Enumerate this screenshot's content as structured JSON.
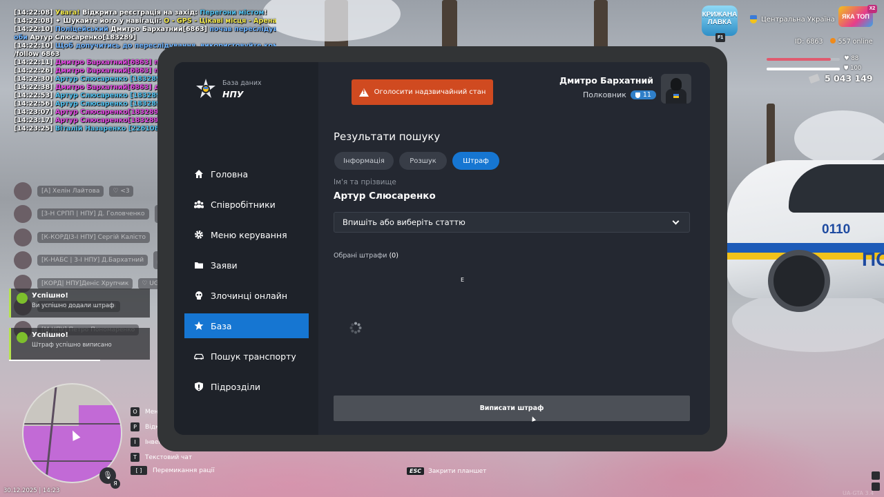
{
  "chat": [
    {
      "time": "[14:22:08]",
      "parts": [
        {
          "t": " Увага! ",
          "c": "c-yellow"
        },
        {
          "t": "Відкрита реєстрація на захід: ",
          "c": "c-white"
        },
        {
          "t": "Перегони містом",
          "c": "c-cyan"
        },
        {
          "t": "!",
          "c": "c-white"
        }
      ]
    },
    {
      "time": "[14:22:08]",
      "parts": [
        {
          "t": " ✦  Шукайте його у навігації: ",
          "c": "c-white"
        },
        {
          "t": "O - GPS - Цікаві місця - Арена",
          "c": "c-yellow"
        }
      ]
    },
    {
      "time": "[14:22:10]",
      "parts": [
        {
          "t": " Поліцейський ",
          "c": "c-blue"
        },
        {
          "t": "Дмитро Бархатний[6863] ",
          "c": "c-white"
        },
        {
          "t": "почав переслідування ос",
          "c": "c-blue"
        }
      ]
    },
    {
      "time": "",
      "parts": [
        {
          "t": "оби ",
          "c": "c-blue"
        },
        {
          "t": "Артур Слюсаренко[183289]",
          "c": "c-white"
        }
      ]
    },
    {
      "time": "[14:22:10]",
      "parts": [
        {
          "t": " Щоб допучитись до переслідування, використовуйте команду:",
          "c": "c-blue"
        }
      ]
    },
    {
      "time": "",
      "parts": [
        {
          "t": "/follow 6863",
          "c": "c-white"
        }
      ]
    },
    {
      "time": "[14:22:11]",
      "parts": [
        {
          "t": " Дмитро Бархатний[6863] перекусив(ла)",
          "c": "c-pink"
        }
      ]
    },
    {
      "time": "[14:22:26]",
      "parts": [
        {
          "t": " Дмитро Бархатний[6863] постукав(ла) у вікно",
          "c": "c-pink"
        }
      ]
    },
    {
      "time": "[14:22:30]",
      "parts": [
        {
          "t": " Артур Слюсаренко [183289]",
          "c": "c-cyan"
        },
        {
          "t": ": драсте",
          "c": "c-white"
        }
      ]
    },
    {
      "time": "[14:22:38]",
      "parts": [
        {
          "t": " Дмитро Бархатний[6863] дістав(ла) посвідчення",
          "c": "c-pink"
        }
      ]
    },
    {
      "time": "[14:22:53]",
      "parts": [
        {
          "t": " Артур Слюсаренко [183289]",
          "c": "c-cyan"
        },
        {
          "t": ": мене занесло",
          "c": "c-white"
        }
      ]
    },
    {
      "time": "[14:22:56]",
      "parts": [
        {
          "t": " Артур Слюсаренко [183289]",
          "c": "c-cyan"
        },
        {
          "t": ": я не винен",
          "c": "c-white"
        }
      ]
    },
    {
      "time": "[14:23:07]",
      "parts": [
        {
          "t": " Артур Слюсаренко[183289] дістав(ла) вод.посвідчення",
          "c": "c-pink"
        }
      ]
    },
    {
      "time": "[14:23:17]",
      "parts": [
        {
          "t": " Артур Слюсаренко[183289] дістав(ла) тех.паспорт",
          "c": "c-pink"
        }
      ]
    },
    {
      "time": "[14:23:25]",
      "parts": [
        {
          "t": " Віталій Назаренко [226108]",
          "c": "c-cyan"
        },
        {
          "t": ": допомога треба?",
          "c": "c-white"
        }
      ]
    }
  ],
  "voice_list": [
    {
      "name": "[А] Хелін Лайтова",
      "tag": "♡ <3"
    },
    {
      "name": "[3-Н СРПП | НПУ] Д. Головченко",
      "tag": "♡ UGTA"
    },
    {
      "name": "[К-КОРДІЗ-І НПУ] Сергій Калісто",
      "tag": ""
    },
    {
      "name": "[К-НАБС | 3-І НПУ] Д.Бархатний",
      "tag": "♡ UGTA"
    },
    {
      "name": "[КОРД| НПУ]Деніс Хрупчик",
      "tag": "♡ UGTA"
    },
    {
      "name": "[М НПУ] Ваня Лінський",
      "tag": ""
    },
    {
      "name": "[М НПУ] Петро Пономаренко",
      "tag": ""
    }
  ],
  "notifications": [
    {
      "title": "Успішно!",
      "text": "Ви успішно додали штраф"
    },
    {
      "title": "Успішно!",
      "text": "Штраф успішно виписано"
    }
  ],
  "keybinds": [
    {
      "key": "O",
      "label": "Мені"
    },
    {
      "key": "P",
      "label": "Відк"
    },
    {
      "key": "I",
      "label": "Інвент"
    },
    {
      "key": "T",
      "label": "Текстовий чат"
    },
    {
      "key": "[ ]",
      "label": "Перемикання рації"
    }
  ],
  "datetime": "30.12.2025 | 14:23",
  "mic_lang": "Я",
  "hud": {
    "logo_left": "КРИЖАНА ЛАВКА",
    "logo_left_key": "F1",
    "server": "Центральна Україна",
    "logo_right": "ЯКА ТОП",
    "logo_right_badge": "X2",
    "id": "ID: 6863",
    "online": "557 online",
    "health": "88",
    "health_level": 88,
    "armor": "100",
    "armor_level": 100,
    "money": "5 043 149"
  },
  "tablet": {
    "brand_sub": "База даних",
    "brand_title": "НПУ",
    "alert_button": "Оголосити надзвичайний стан",
    "user_name": "Дмитро Бархатний",
    "user_rank": "Полковник",
    "user_rank_level": "11",
    "nav": [
      {
        "label": "Головна",
        "icon": "home-icon"
      },
      {
        "label": "Співробітники",
        "icon": "users-icon"
      },
      {
        "label": "Меню керування",
        "icon": "gear-icon"
      },
      {
        "label": "Заяви",
        "icon": "folder-icon"
      },
      {
        "label": "Злочинці онлайн",
        "icon": "skull-icon"
      },
      {
        "label": "База",
        "icon": "star-icon",
        "active": true
      },
      {
        "label": "Пошук транспорту",
        "icon": "car-icon"
      },
      {
        "label": "Підрозділи",
        "icon": "shield-icon"
      }
    ],
    "results_title": "Результати пошуку",
    "tabs": [
      {
        "label": "Інформація"
      },
      {
        "label": "Розшук"
      },
      {
        "label": "Штраф",
        "active": true
      }
    ],
    "name_label": "Ім'я та прізвище",
    "name_value": "Артур Слюсаренко",
    "select_placeholder": "Впишіть або виберіть статтю",
    "selected_label": "Обрані штрафи",
    "selected_count": "(0)",
    "cursor_char": "E",
    "submit_button": "Виписати штраф"
  },
  "esc_hint": {
    "key": "ESC",
    "label": "Закрити планшет"
  },
  "watermark": "UA-GTA 3.4",
  "colors": {
    "accent": "#1676d2",
    "alert": "#d04a20",
    "success": "#b6e34c"
  }
}
